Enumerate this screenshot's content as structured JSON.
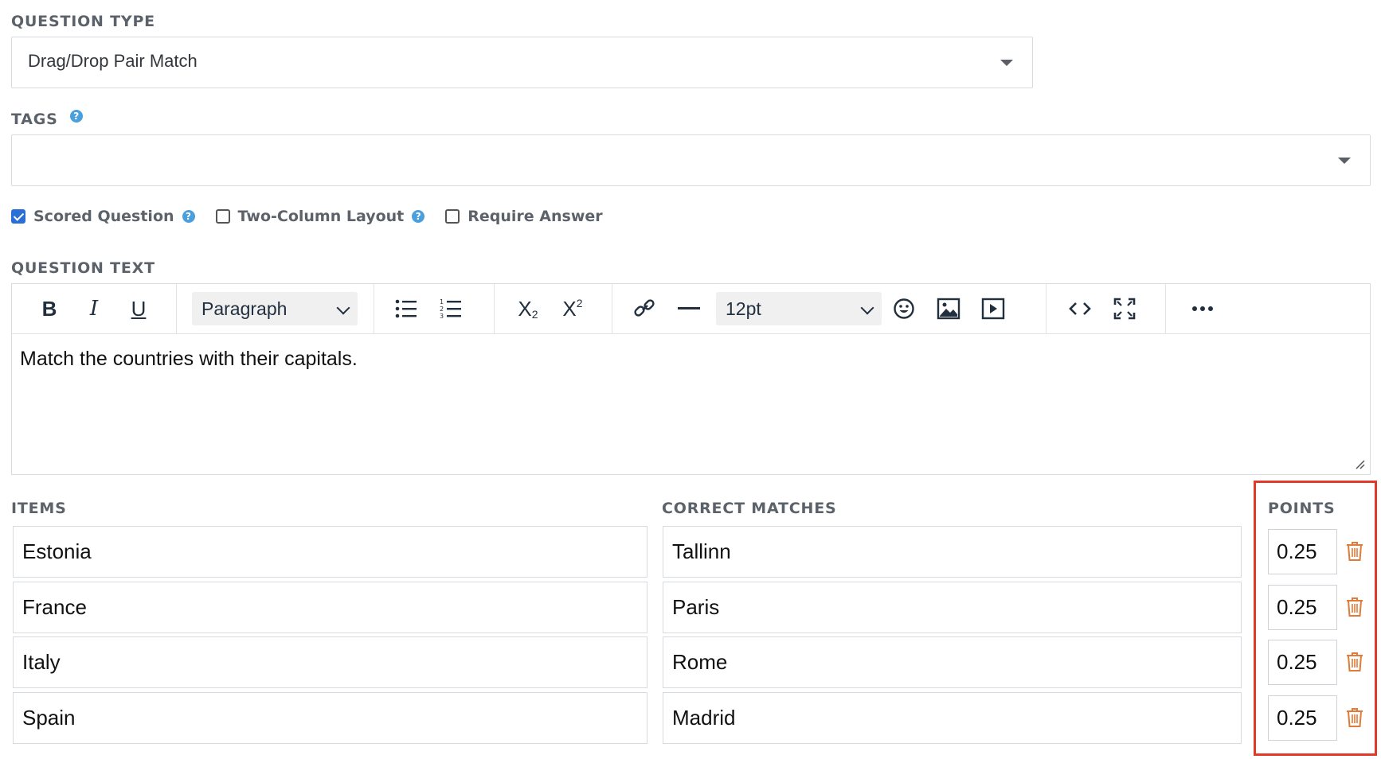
{
  "question_type": {
    "label": "QUESTION TYPE",
    "value": "Drag/Drop Pair Match"
  },
  "tags": {
    "label": "TAGS",
    "help": "?",
    "value": ""
  },
  "options": [
    {
      "label": "Scored Question",
      "checked": true,
      "help": "?"
    },
    {
      "label": "Two-Column Layout",
      "checked": false,
      "help": "?"
    },
    {
      "label": "Require Answer",
      "checked": false
    }
  ],
  "question_text": {
    "label": "QUESTION TEXT",
    "toolbar": {
      "block_format": "Paragraph",
      "font_size": "12pt",
      "icons": [
        "bold-icon",
        "italic-icon",
        "underline-icon",
        "bullet-list-icon",
        "numbered-list-icon",
        "subscript-icon",
        "superscript-icon",
        "link-icon",
        "horizontal-line-icon",
        "emoji-icon",
        "image-icon",
        "media-icon",
        "code-icon",
        "fullscreen-icon",
        "more-icon"
      ]
    },
    "content": "Match the countries with their capitals."
  },
  "pairs": {
    "items_label": "ITEMS",
    "matches_label": "CORRECT MATCHES",
    "points_label": "POINTS",
    "rows": [
      {
        "item": "Estonia",
        "match": "Tallinn",
        "points": "0.25"
      },
      {
        "item": "France",
        "match": "Paris",
        "points": "0.25"
      },
      {
        "item": "Italy",
        "match": "Rome",
        "points": "0.25"
      },
      {
        "item": "Spain",
        "match": "Madrid",
        "points": "0.25"
      }
    ]
  },
  "colors": {
    "accent": "#2a6fd6",
    "help": "#4a9fdd",
    "delete": "#e07b39",
    "highlight": "#e23a2a"
  }
}
